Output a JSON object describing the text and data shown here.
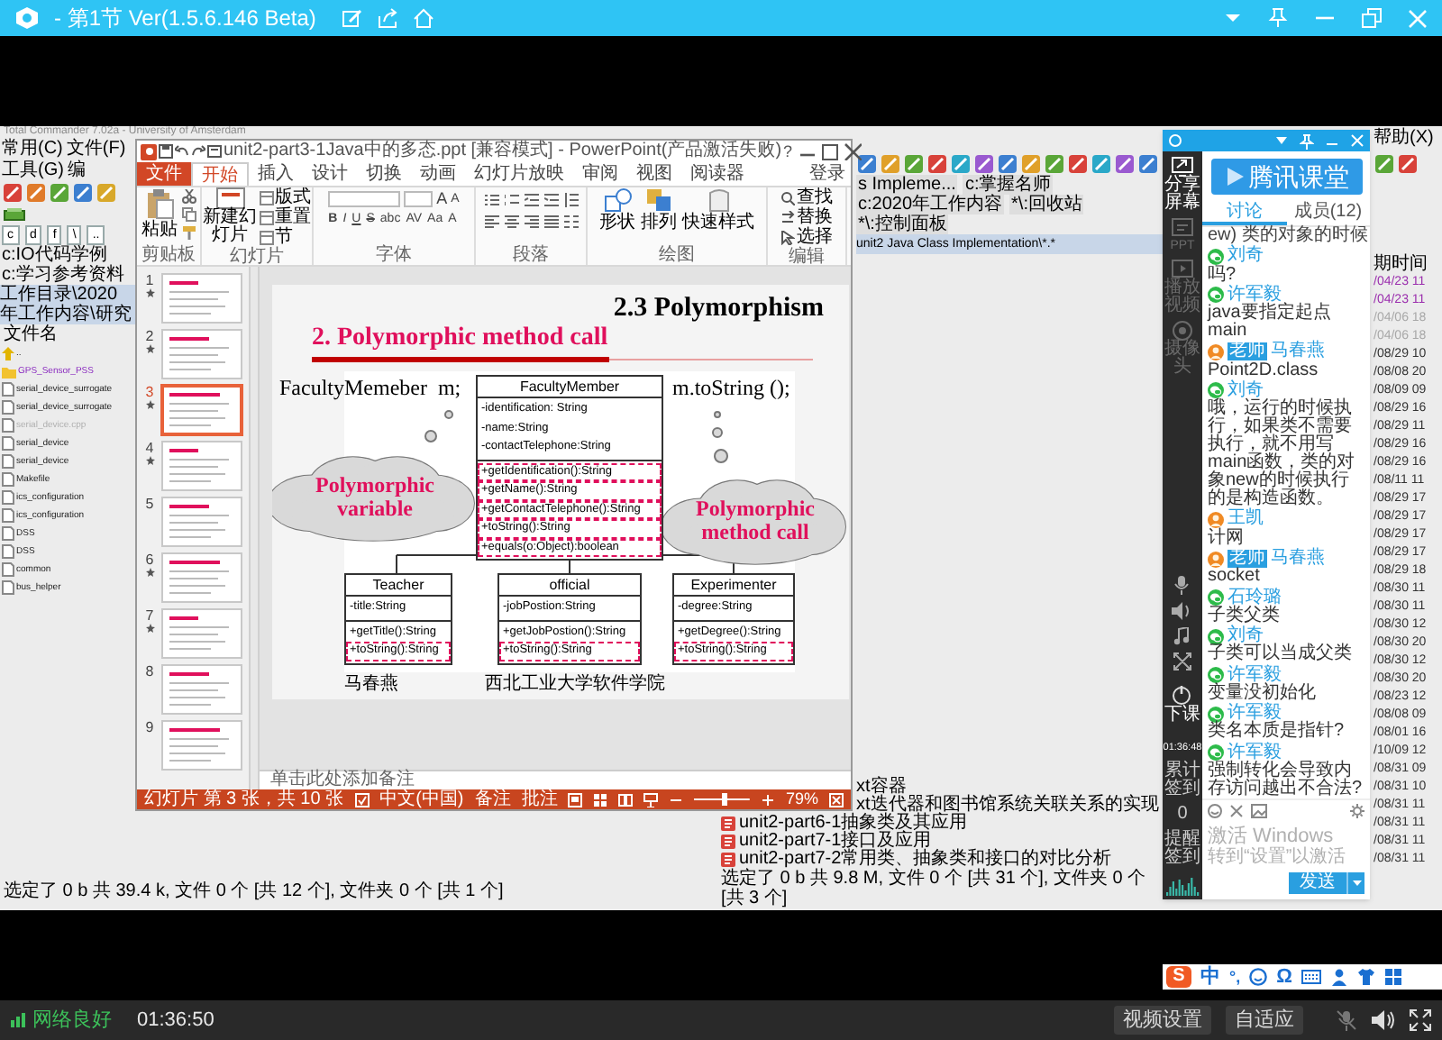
{
  "player": {
    "title": "- 第1节 Ver(1.5.6.146 Beta)",
    "network": "网络良好",
    "elapsed": "01:36:50",
    "buttons": [
      "视频设置",
      "自适应"
    ]
  },
  "total_commander": {
    "title": "Total Commander 7.02a - University of Amsterdam",
    "menus": [
      "常用(C)",
      "文件(F)",
      "工具(G)",
      "编"
    ],
    "help_menu": "帮助(X)",
    "left_panel": {
      "drives": [
        "c",
        "d",
        "f",
        "\\",
        ".."
      ],
      "tabs": [
        "c:IO代码学例",
        "c:学习参考资料"
      ],
      "path": "工作目录\\2020年工作内容\\研究",
      "column": "文件名",
      "files": [
        {
          "name": "..",
          "kind": "up",
          "disabled": false
        },
        {
          "name": "GPS_Sensor_PSS",
          "kind": "folder",
          "disabled": false
        },
        {
          "name": "serial_device_surrogate",
          "kind": "file",
          "disabled": false
        },
        {
          "name": "serial_device_surrogate",
          "kind": "file",
          "disabled": false
        },
        {
          "name": "serial_device.cpp",
          "kind": "file",
          "disabled": true
        },
        {
          "name": "serial_device",
          "kind": "file",
          "disabled": false
        },
        {
          "name": "serial_device",
          "kind": "file",
          "disabled": false
        },
        {
          "name": "Makefile",
          "kind": "file",
          "disabled": false
        },
        {
          "name": "ics_configuration",
          "kind": "file",
          "disabled": false
        },
        {
          "name": "ics_configuration",
          "kind": "file",
          "disabled": false
        },
        {
          "name": "DSS",
          "kind": "file",
          "disabled": false
        },
        {
          "name": "DSS",
          "kind": "file",
          "disabled": false
        },
        {
          "name": "common",
          "kind": "file",
          "disabled": false
        },
        {
          "name": "bus_helper",
          "kind": "file",
          "disabled": false
        }
      ],
      "status": "选定了 0 b 共 39.4 k, 文件 0 个 [共 12 个], 文件夹 0 个 [共 1 个]"
    },
    "right_panel": {
      "tabs": [
        "s Impleme...",
        "c:掌握名师",
        "c:2020年工作内容",
        "*\\:回收站",
        "*\\:控制面板"
      ],
      "path": "unit2 Java Class Implementation\\*.*",
      "date_column": "期时间",
      "rows": [
        {
          "date": "/04/23 11",
          "color": "#9b2fae"
        },
        {
          "date": "/04/23 11",
          "color": "#9b2fae"
        },
        {
          "date": "/04/06 18",
          "color": "#a8a8a8"
        },
        {
          "date": "/04/06 18",
          "color": "#a8a8a8"
        },
        {
          "date": "/08/29 10",
          "color": "#333333"
        },
        {
          "date": "/08/08 20",
          "color": "#333333"
        },
        {
          "date": "/08/09 09",
          "color": "#333333"
        },
        {
          "date": "/08/29 16",
          "color": "#333333"
        },
        {
          "date": "/08/29 11",
          "color": "#333333"
        },
        {
          "date": "/08/29 16",
          "color": "#333333"
        },
        {
          "date": "/08/29 16",
          "color": "#333333"
        },
        {
          "date": "/08/11 11",
          "color": "#333333"
        },
        {
          "date": "/08/29 17",
          "color": "#333333"
        },
        {
          "date": "/08/29 17",
          "color": "#333333"
        },
        {
          "date": "/08/29 17",
          "color": "#333333"
        },
        {
          "date": "/08/29 17",
          "color": "#333333"
        },
        {
          "date": "/08/29 18",
          "color": "#333333"
        },
        {
          "date": "/08/30 11",
          "color": "#333333"
        },
        {
          "date": "/08/30 11",
          "color": "#333333"
        },
        {
          "date": "/08/30 12",
          "color": "#333333"
        },
        {
          "date": "/08/30 20",
          "color": "#333333"
        },
        {
          "date": "/08/30 12",
          "color": "#333333"
        },
        {
          "date": "/08/30 20",
          "color": "#333333"
        },
        {
          "date": "/08/23 12",
          "color": "#333333"
        },
        {
          "date": "/08/08 09",
          "color": "#333333"
        },
        {
          "date": "/08/01 16",
          "color": "#333333"
        },
        {
          "date": "/10/09 12",
          "color": "#333333"
        },
        {
          "date": "/08/31 09",
          "color": "#333333"
        },
        {
          "name": "xt容器",
          "date": "/08/31 10",
          "color": "#333333"
        },
        {
          "name": "xt迭代器和图书馆系统关联关系的实现",
          "date": "/08/31 11",
          "color": "#333333"
        },
        {
          "name": "unit2-part6-1抽象类及其应用",
          "date": "/08/31 11",
          "color": "#333333"
        },
        {
          "name": "unit2-part7-1接口及应用",
          "date": "/08/31 11",
          "color": "#333333"
        },
        {
          "name": "unit2-part7-2常用类、抽象类和接口的对比分析",
          "date": "/08/31 11",
          "color": "#333333"
        }
      ],
      "status": "选定了 0 b 共 9.8 M, 文件 0 个 [共 31 个], 文件夹 0 个 [共 3 个]"
    }
  },
  "powerpoint": {
    "title": "unit2-part3-1Java中的多态.ppt [兼容模式] - PowerPoint(产品激活失败)",
    "help": "?",
    "tabs": [
      {
        "label": "文件",
        "kind": "file",
        "selected": false
      },
      {
        "label": "开始",
        "kind": "tab",
        "selected": true
      },
      {
        "label": "插入",
        "kind": "tab",
        "selected": false
      },
      {
        "label": "设计",
        "kind": "tab",
        "selected": false
      },
      {
        "label": "切换",
        "kind": "tab",
        "selected": false
      },
      {
        "label": "动画",
        "kind": "tab",
        "selected": false
      },
      {
        "label": "幻灯片放映",
        "kind": "tab",
        "selected": false
      },
      {
        "label": "审阅",
        "kind": "tab",
        "selected": false
      },
      {
        "label": "视图",
        "kind": "tab",
        "selected": false
      },
      {
        "label": "阅读器",
        "kind": "tab",
        "selected": false
      }
    ],
    "account": "登录",
    "groups": [
      {
        "label": "剪贴板",
        "kind": "clipboard",
        "buttons": [
          "粘贴"
        ]
      },
      {
        "label": "幻灯片",
        "kind": "slides",
        "buttons": [
          "新建幻灯片",
          "版式",
          "重置",
          "节"
        ]
      },
      {
        "label": "字体",
        "kind": "font",
        "buttons": [
          "A",
          "A",
          "B",
          "I",
          "U",
          "S",
          "abc",
          "AV",
          "Aa",
          "A"
        ]
      },
      {
        "label": "段落",
        "kind": "paragraph"
      },
      {
        "label": "绘图",
        "kind": "drawing",
        "buttons": [
          "形状",
          "排列",
          "快速样式"
        ]
      },
      {
        "label": "编辑",
        "kind": "editing",
        "buttons": [
          "查找",
          "替换",
          "选择"
        ]
      }
    ],
    "slides": [
      {
        "number": "1",
        "animated": true,
        "selected": false
      },
      {
        "number": "2",
        "animated": true,
        "selected": false
      },
      {
        "number": "3",
        "animated": true,
        "selected": true
      },
      {
        "number": "4",
        "animated": true,
        "selected": false
      },
      {
        "number": "5",
        "animated": false,
        "selected": false
      },
      {
        "number": "6",
        "animated": true,
        "selected": false
      },
      {
        "number": "7",
        "animated": true,
        "selected": false
      },
      {
        "number": "8",
        "animated": false,
        "selected": false
      },
      {
        "number": "9",
        "animated": false,
        "selected": false
      }
    ],
    "slide": {
      "heading": "2.3 Polymorphism",
      "subtitle": "2. Polymorphic method call",
      "declaration": "FacultyMemeber  m;",
      "call": "m.toString ();",
      "callouts": [
        "Polymorphic variable",
        "Polymorphic method call"
      ],
      "base_class": {
        "name": "FacultyMember",
        "attributes": [
          "-identification: String",
          "-name:String",
          "-contactTelephone:String"
        ],
        "methods": [
          {
            "text": "+getIdentification():String",
            "highlighted": true
          },
          {
            "text": "+getName():String",
            "highlighted": true
          },
          {
            "text": "+getContactTelephone():String",
            "highlighted": true
          },
          {
            "text": "+toString():String",
            "highlighted": true
          },
          {
            "text": "+equals(o:Object):boolean",
            "highlighted": true
          }
        ]
      },
      "subclasses": [
        {
          "name": "Teacher",
          "attributes": [
            "-title:String"
          ],
          "methods": [
            {
              "text": "+getTitle():String",
              "highlighted": false
            },
            {
              "text": "+toString():String",
              "highlighted": true
            }
          ]
        },
        {
          "name": "official",
          "attributes": [
            "-jobPostion:String"
          ],
          "methods": [
            {
              "text": "+getJobPostion():String",
              "highlighted": false
            },
            {
              "text": "+toString():String",
              "highlighted": true
            }
          ]
        },
        {
          "name": "Experimenter",
          "attributes": [
            "-degree:String"
          ],
          "methods": [
            {
              "text": "+getDegree():String",
              "highlighted": false
            },
            {
              "text": "+toString():String",
              "highlighted": true
            }
          ]
        }
      ],
      "footer": [
        "马春燕",
        "西北工业大学软件学院"
      ]
    },
    "notes_placeholder": "单击此处添加备注",
    "status": {
      "slide_info": "幻灯片 第 3 张，共 10 张",
      "language": "中文(中国)",
      "notes": "备注",
      "comments": "批注",
      "zoom": {
        "level": 0.55,
        "reading": "79%"
      }
    }
  },
  "chat": {
    "brand": "腾讯课堂",
    "tabs": [
      {
        "label": "讨论",
        "selected": true
      },
      {
        "label": "成员(12)",
        "selected": false
      }
    ],
    "tools": [
      {
        "label": "分享屏幕",
        "kind": "share",
        "disabled": false
      },
      {
        "label": "PPT",
        "kind": "ppt",
        "disabled": true
      },
      {
        "label": "播放视频",
        "kind": "video",
        "disabled": true
      },
      {
        "label": "摄像头",
        "kind": "camera",
        "disabled": true
      }
    ],
    "end_class": "下课",
    "timer": "01:36:48",
    "checkin": [
      "累计签到",
      "0",
      "提醒签到"
    ],
    "earlier_message": "ew) 类的对象的时候",
    "messages": [
      {
        "author": "刘奇",
        "kind": "wechat",
        "text": "吗?"
      },
      {
        "author": "许军毅",
        "kind": "wechat",
        "text": "java要指定起点main"
      },
      {
        "author": "马春燕",
        "kind": "photo",
        "badge": "老师",
        "text": "Point2D.class"
      },
      {
        "author": "刘奇",
        "kind": "wechat",
        "text": "哦，运行的时候执行，如果类不需要执行，就不用写main函数，类的对象new的时候执行的是构造函数。"
      },
      {
        "author": "王凯",
        "kind": "photo",
        "text": "计网"
      },
      {
        "author": "马春燕",
        "kind": "photo",
        "badge": "老师",
        "text": "socket"
      },
      {
        "author": "石玲璐",
        "kind": "wechat",
        "text": "子类父类"
      },
      {
        "author": "刘奇",
        "kind": "wechat",
        "text": "子类可以当成父类"
      },
      {
        "author": "许军毅",
        "kind": "wechat",
        "text": "变量没初始化"
      },
      {
        "author": "许军毅",
        "kind": "wechat",
        "text": "类名本质是指针?"
      },
      {
        "author": "许军毅",
        "kind": "wechat",
        "text": "强制转化会导致内存访问越出不合法?"
      }
    ],
    "activation": {
      "title": "激活 Windows",
      "hint": "转到“设置”以激活"
    },
    "send": "发送"
  },
  "ime_bar": {
    "logo": "S",
    "mode": "中",
    "punctuation": "°,",
    "symbol": "Ω"
  }
}
